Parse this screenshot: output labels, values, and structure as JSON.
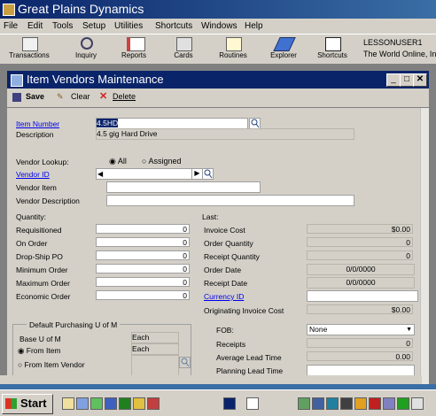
{
  "app": {
    "title": "Great Plains Dynamics"
  },
  "menu": [
    "File",
    "Edit",
    "Tools",
    "Setup",
    "Utilities",
    "Shortcuts",
    "Windows",
    "Help"
  ],
  "toolbar": {
    "buttons": [
      "Transactions",
      "Inquiry",
      "Reports",
      "Cards",
      "Routines",
      "Explorer",
      "Shortcuts"
    ],
    "user": "LESSONUSER1",
    "company": "The World Online, Inc"
  },
  "window": {
    "title": "Item Vendors Maintenance",
    "actions": {
      "save": "Save",
      "clear": "Clear",
      "delete": "Delete"
    }
  },
  "form": {
    "item_number_label": "Item Number",
    "item_number": "4.5HD",
    "description_label": "Description",
    "description": "4.5 gig Hard Drive",
    "vendor_lookup_label": "Vendor Lookup:",
    "vendor_lookup_all": "All",
    "vendor_lookup_assigned": "Assigned",
    "vendor_id_label": "Vendor ID",
    "vendor_item_label": "Vendor Item",
    "vendor_description_label": "Vendor Description",
    "quantity_heading": "Quantity:",
    "quantity": [
      {
        "label": "Requisitioned",
        "value": "0"
      },
      {
        "label": "On Order",
        "value": "0"
      },
      {
        "label": "Drop-Ship PO",
        "value": "0"
      },
      {
        "label": "Minimum Order",
        "value": "0"
      },
      {
        "label": "Maximum Order",
        "value": "0"
      },
      {
        "label": "Economic Order",
        "value": "0"
      }
    ],
    "last_heading": "Last:",
    "last": [
      {
        "label": "Invoice Cost",
        "value": "$0.00"
      },
      {
        "label": "Order Quantity",
        "value": "0"
      },
      {
        "label": "Receipt Quantity",
        "value": "0"
      },
      {
        "label": "Order Date",
        "value": "0/0/0000"
      },
      {
        "label": "Receipt Date",
        "value": "0/0/0000"
      }
    ],
    "currency_id_label": "Currency ID",
    "originating_invoice_cost_label": "Originating Invoice Cost",
    "originating_invoice_cost": "$0.00",
    "default_purchasing_label": "Default Purchasing U of M",
    "base_uom_label": "Base U of M",
    "from_item_label": "From Item",
    "from_item_vendor_label": "From Item Vendor",
    "uom_values": [
      "Each",
      "Each"
    ],
    "fob_label": "FOB:",
    "fob_value": "None",
    "receipts_label": "Receipts",
    "receipts_value": "0",
    "average_lead_time_label": "Average Lead Time",
    "average_lead_time_value": "0.00",
    "planning_lead_time_label": "Planning Lead Time"
  },
  "taskbar": {
    "start": "Start"
  }
}
